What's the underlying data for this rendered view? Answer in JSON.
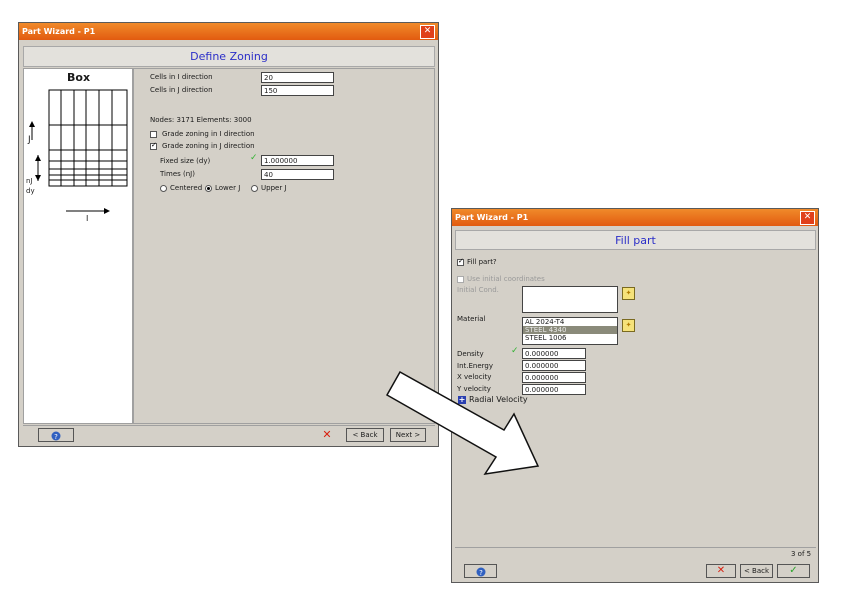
{
  "win1": {
    "title": "Part Wizard - P1",
    "header": "Define Zoning",
    "box_label": "Box",
    "diagram_labels": {
      "j": "J",
      "nj": "nJ",
      "dy": "dy",
      "i": "I"
    },
    "rows": [
      {
        "label": "Cells in I direction",
        "value": "20"
      },
      {
        "label": "Cells in J direction",
        "value": "150"
      }
    ],
    "nodes_text": "Nodes: 3171 Elements: 3000",
    "grade_i_label": "Grade zoning in I direction",
    "grade_j_label": "Grade zoning in J direction",
    "fixed_size_label": "Fixed size (dy)",
    "fixed_size_value": "1.000000",
    "times_label": "Times (nJ)",
    "times_value": "40",
    "radio_options": [
      "Centered",
      "Lower J",
      "Upper J"
    ],
    "radio_selected": "Lower J",
    "back_label": "Back",
    "next_label": "Next"
  },
  "win2": {
    "title": "Part Wizard - P1",
    "header": "Fill part",
    "fill_part_label": "Fill part?",
    "use_initial_label": "Use initial coordinates",
    "initial_cond_label": "Initial Cond.",
    "material_label": "Material",
    "materials": [
      "AL 2024-T4",
      "STEEL 4340",
      "STEEL 1006"
    ],
    "material_selected": "STEEL 4340",
    "density_label": "Density",
    "density_value": "0.000000",
    "int_energy_label": "Int.Energy",
    "int_energy_value": "0.000000",
    "xvel_label": "X velocity",
    "xvel_value": "0.000000",
    "yvel_label": "Y velocity",
    "yvel_value": "0.000000",
    "radial_label": "Radial Velocity",
    "page": "3 of 5",
    "back_label": "Back"
  },
  "colors": {
    "titlebar": "#e25b10",
    "header_text": "#2b2ec8",
    "panel": "#d4d0c8",
    "arrow": "#ffffff"
  }
}
